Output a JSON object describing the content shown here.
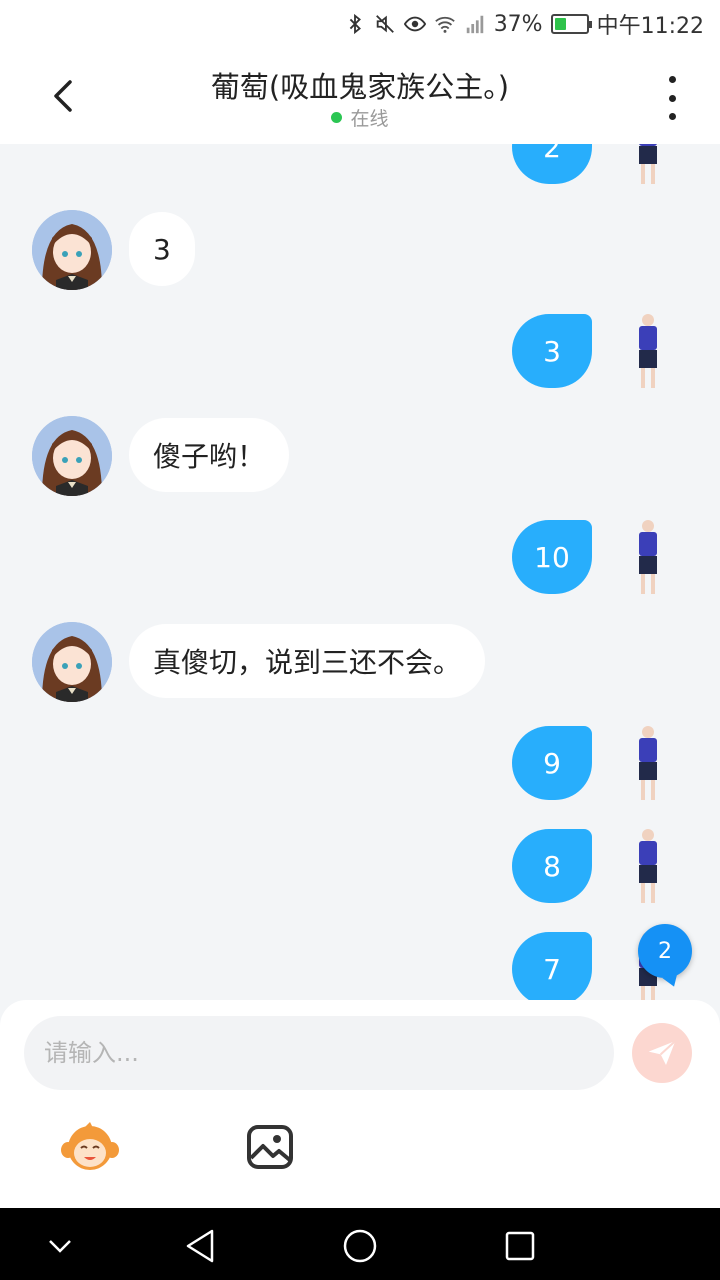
{
  "status_bar": {
    "battery_percent": "37%",
    "time": "中午11:22",
    "battery_level": 0.37,
    "icons": [
      "bluetooth-icon",
      "mute-icon",
      "eye-icon",
      "wifi-icon",
      "signal-icon",
      "battery-icon"
    ]
  },
  "header": {
    "title": "葡萄(吸血鬼家族公主。)",
    "status": "在线",
    "status_color": "#2bc653"
  },
  "messages": [
    {
      "side": "right",
      "text": "2"
    },
    {
      "side": "left",
      "text": "3"
    },
    {
      "side": "right",
      "text": "3"
    },
    {
      "side": "left",
      "text": "傻子哟！"
    },
    {
      "side": "right",
      "text": "10"
    },
    {
      "side": "left",
      "text": "真傻切，说到三还不会。"
    },
    {
      "side": "right",
      "text": "9"
    },
    {
      "side": "right",
      "text": "8"
    },
    {
      "side": "right",
      "text": "7"
    }
  ],
  "unread_badge": "2",
  "input": {
    "placeholder": "请输入...",
    "value": ""
  },
  "colors": {
    "accent": "#28aefc",
    "send_disabled": "#fcd7d0",
    "background": "#f3f5f7"
  }
}
